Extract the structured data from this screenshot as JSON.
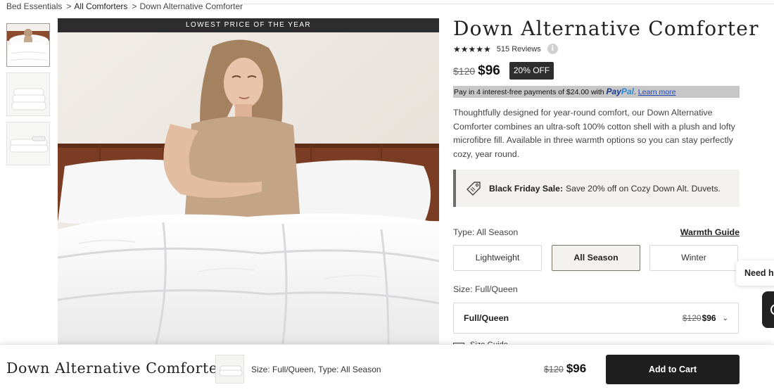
{
  "breadcrumb": {
    "items": [
      "Bed Essentials",
      "All Comforters",
      "Down Alternative Comforter"
    ],
    "separator": ">"
  },
  "gallery": {
    "thumbnails": [
      "woman-on-comforter-photo",
      "folded-comforter-photo",
      "stacked-comforter-photo"
    ],
    "active_index": 0,
    "banner": "LOWEST PRICE OF THE YEAR"
  },
  "product": {
    "title": "Down Alternative Comforter",
    "rating_stars": "★★★★★",
    "reviews": "515 Reviews",
    "info_icon_glyph": "i",
    "price_old": "$120",
    "price_new": "$96",
    "discount_badge": "20% OFF",
    "description": "Thoughtfully designed for year-round comfort, our Down Alternative Comforter combines an ultra-soft 100% cotton shell with a plush and lofty microfibre fill. Available in three warmth options so you can stay perfectly cozy, year round."
  },
  "paypal": {
    "text": "Pay in 4 interest-free payments of $24.00 with",
    "logo_pay": "Pay",
    "logo_pal": "Pal",
    "dot": ".",
    "learn_more": "Learn more"
  },
  "promo": {
    "bold": "Black Friday Sale:",
    "text": "Save 20% off on Cozy Down Alt. Duvets."
  },
  "type": {
    "label": "Type: All Season",
    "guide_link": "Warmth Guide",
    "options": [
      "Lightweight",
      "All Season",
      "Winter"
    ],
    "selected": "All Season"
  },
  "size": {
    "label": "Size: Full/Queen",
    "selected": "Full/Queen",
    "price_old": "$120",
    "price_new": "$96",
    "chevron": "⌄",
    "guide_peek": "Size Guide"
  },
  "help": {
    "label": "Need help?"
  },
  "sticky_bar": {
    "title": "Down Alternative Comforter",
    "meta": "Size: Full/Queen, Type: All Season",
    "price_old": "$120",
    "price_new": "$96",
    "cta": "Add to Cart"
  },
  "colors": {
    "dark": "#1f1f1f",
    "banner": "#2d2d2d",
    "paypal_bar": "#c7c7c7",
    "promo_bg": "#f2f1ef",
    "selected_option_bg": "#f4f2ee",
    "paypal_blue": "#1b3d8f",
    "link_blue": "#1f47b8"
  }
}
